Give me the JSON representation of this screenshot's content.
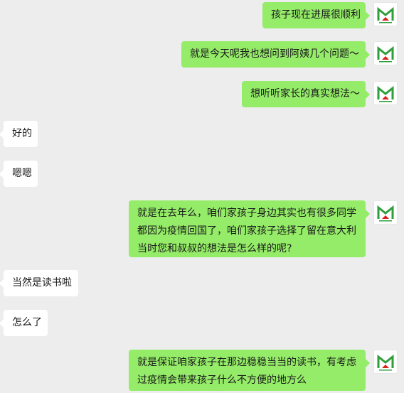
{
  "colors": {
    "background": "#ededed",
    "outgoing_bubble": "#95ec69",
    "incoming_bubble": "#ffffff",
    "avatar_green": "#2e9e3a",
    "avatar_red": "#d6221d"
  },
  "avatar_icon": "school-logo-icon",
  "messages": [
    {
      "side": "out",
      "lines": [
        "孩子现在进展很顺利"
      ]
    },
    {
      "side": "out",
      "lines": [
        "就是今天呢我也想问到阿姨几个问题～"
      ]
    },
    {
      "side": "out",
      "lines": [
        "想听听家长的真实想法～"
      ]
    },
    {
      "side": "in",
      "lines": [
        "好的"
      ]
    },
    {
      "side": "in",
      "lines": [
        "嗯嗯"
      ]
    },
    {
      "side": "out",
      "lines": [
        "就是在去年么，咱们家孩子身边其实也有很多同学",
        "都因为疫情回国了，咱们家孩子选择了留在意大利",
        "当时您和叔叔的想法是怎么样的呢?"
      ]
    },
    {
      "side": "in",
      "lines": [
        "当然是读书啦"
      ]
    },
    {
      "side": "in",
      "lines": [
        "怎么了"
      ]
    },
    {
      "side": "out",
      "lines": [
        "就是保证咱家孩子在那边稳稳当当的读书，有考虑",
        "过疫情会带来孩子什么不方便的地方么"
      ]
    }
  ]
}
